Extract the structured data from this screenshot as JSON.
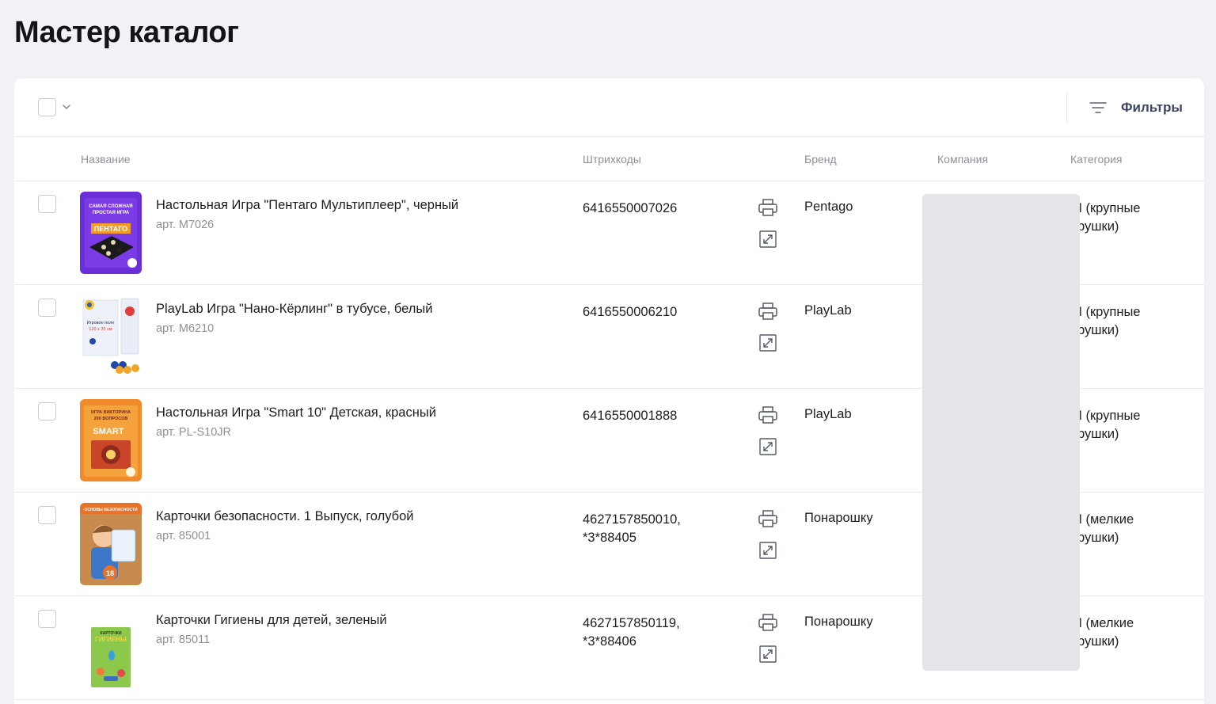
{
  "page": {
    "title": "Мастер каталог"
  },
  "toolbar": {
    "filters_label": "Фильтры"
  },
  "columns": {
    "name": "Название",
    "barcodes": "Штрихкоды",
    "brand": "Бренд",
    "company": "Компания",
    "category": "Категория"
  },
  "rows": [
    {
      "name": "Настольная Игра \"Пентаго Мультиплеер\", черный",
      "sku": "арт. M7026",
      "barcode": "6416550007026",
      "brand": "Pentago",
      "category": "И (крупные\nгрушки)",
      "thumb_texts": [
        "САМАЯ СЛОЖНАЯ",
        "ПРОСТАЯ ИГРА",
        "ПЕНТАГО"
      ]
    },
    {
      "name": "PlayLab Игра \"Нано-Кёрлинг\" в тубусе, белый",
      "sku": "арт. M6210",
      "barcode": "6416550006210",
      "brand": "PlayLab",
      "category": "И (крупные\nгрушки)",
      "thumb_texts": [
        "Игровое поле",
        "120 x 35 см"
      ]
    },
    {
      "name": "Настольная Игра \"Smart 10\" Детская, красный",
      "sku": "арт. PL-S10JR",
      "barcode": "6416550001888",
      "brand": "PlayLab",
      "category": "И (крупные\nгрушки)",
      "thumb_texts": [
        "ИГРА ВИКТОРИНА",
        "200 ВОПРОСОВ",
        "SMART"
      ]
    },
    {
      "name": "Карточки безопасности. 1 Выпуск, голубой",
      "sku": "арт. 85001",
      "barcode": "4627157850010,\n*3*88405",
      "brand": "Понарошку",
      "category": "И (мелкие\nгрушки)",
      "thumb_texts": [
        "ОСНОВЫ БЕЗОПАСНОСТИ",
        "18"
      ]
    },
    {
      "name": "Карточки Гигиены для детей, зеленый",
      "sku": "арт. 85011",
      "barcode": "4627157850119,\n*3*88406",
      "brand": "Понарошку",
      "category": "И (мелкие\nгрушки)",
      "thumb_texts": [
        "КАРТОЧКИ",
        "ГИГИЕНЫ"
      ]
    }
  ],
  "icons": {
    "select_chevron": "chevron-down-icon",
    "filters": "filter-lines-icon",
    "print": "print-icon",
    "expand": "expand-icon"
  },
  "colors": {
    "background": "#f1f2f6",
    "panel": "#ffffff",
    "muted_text": "#8d909b",
    "filters_text": "#3c4461",
    "redaction": "#e4e4e9"
  }
}
